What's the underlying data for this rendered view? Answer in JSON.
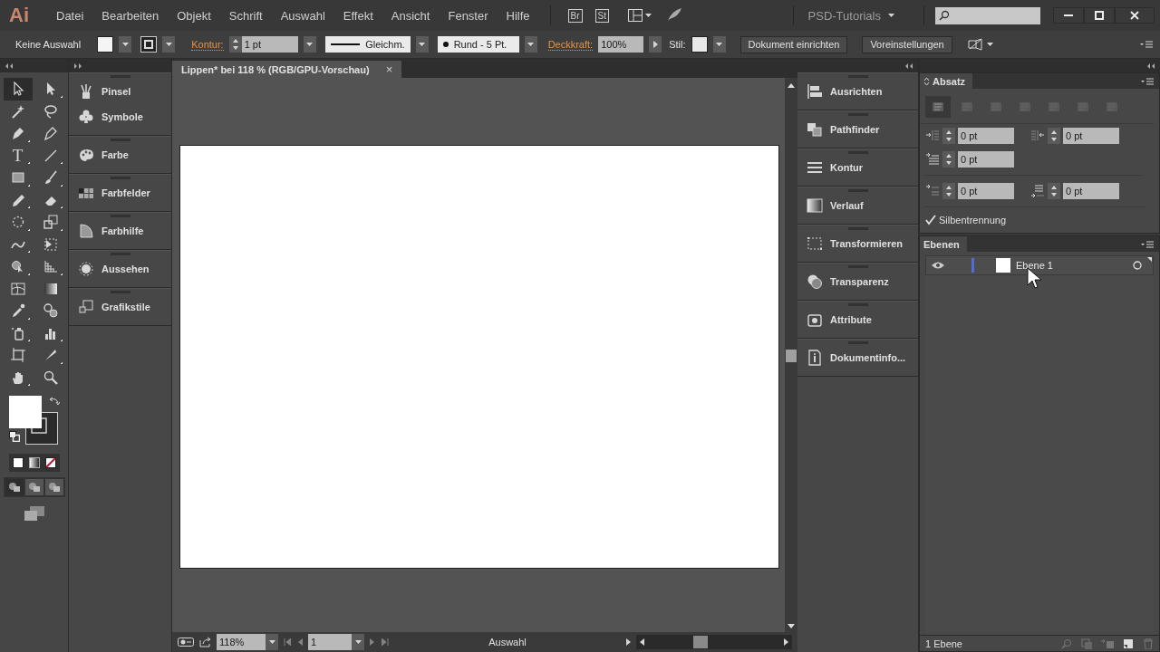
{
  "app": {
    "logo": "Ai"
  },
  "menu": [
    "Datei",
    "Bearbeiten",
    "Objekt",
    "Schrift",
    "Auswahl",
    "Effekt",
    "Ansicht",
    "Fenster",
    "Hilfe"
  ],
  "app_switcher": [
    "Br",
    "St"
  ],
  "workspace": {
    "label": "PSD-Tutorials"
  },
  "control_bar": {
    "selection": "Keine Auswahl",
    "stroke_label": "Kontur:",
    "stroke_weight": "1 pt",
    "stroke_profile": "Gleichm.",
    "brush": "Rund - 5 Pt.",
    "opacity_label": "Deckkraft:",
    "opacity_value": "100%",
    "style_label": "Stil:",
    "buttons": [
      "Dokument einrichten",
      "Voreinstellungen"
    ]
  },
  "tools": [
    {
      "kind": "selection",
      "selected": true,
      "flyout": false
    },
    {
      "kind": "direct-selection",
      "selected": false,
      "flyout": true
    },
    {
      "kind": "magic-wand",
      "selected": false,
      "flyout": false
    },
    {
      "kind": "lasso",
      "selected": false,
      "flyout": false
    },
    {
      "kind": "pen",
      "selected": false,
      "flyout": true
    },
    {
      "kind": "curvature",
      "selected": false,
      "flyout": false
    },
    {
      "kind": "type",
      "glyph": "T",
      "selected": false,
      "flyout": true
    },
    {
      "kind": "line",
      "selected": false,
      "flyout": true
    },
    {
      "kind": "rectangle",
      "selected": false,
      "flyout": true
    },
    {
      "kind": "paintbrush",
      "selected": false,
      "flyout": true
    },
    {
      "kind": "pencil",
      "selected": false,
      "flyout": true
    },
    {
      "kind": "eraser",
      "selected": false,
      "flyout": true
    },
    {
      "kind": "rotate",
      "selected": false,
      "flyout": true
    },
    {
      "kind": "scale",
      "selected": false,
      "flyout": true
    },
    {
      "kind": "warp",
      "selected": false,
      "flyout": true
    },
    {
      "kind": "free-transform",
      "selected": false,
      "flyout": false
    },
    {
      "kind": "shape-builder",
      "selected": false,
      "flyout": true
    },
    {
      "kind": "perspective",
      "selected": false,
      "flyout": true
    },
    {
      "kind": "mesh",
      "selected": false,
      "flyout": false
    },
    {
      "kind": "gradient",
      "selected": false,
      "flyout": false
    },
    {
      "kind": "eyedropper",
      "selected": false,
      "flyout": true
    },
    {
      "kind": "blend",
      "selected": false,
      "flyout": false
    },
    {
      "kind": "sprayer",
      "selected": false,
      "flyout": true
    },
    {
      "kind": "graph",
      "selected": false,
      "flyout": true
    },
    {
      "kind": "artboard",
      "selected": false,
      "flyout": false
    },
    {
      "kind": "slice",
      "selected": false,
      "flyout": true
    },
    {
      "kind": "hand",
      "selected": false,
      "flyout": true
    },
    {
      "kind": "zoom",
      "selected": false,
      "flyout": false
    }
  ],
  "color_modes": [
    {
      "kind": "color"
    },
    {
      "kind": "gradient"
    },
    {
      "kind": "none"
    }
  ],
  "draw_modes": [
    {
      "selected": true
    },
    {
      "selected": false
    },
    {
      "selected": false
    }
  ],
  "left_panels": [
    {
      "items": [
        {
          "kind": "brush",
          "label": "Pinsel"
        },
        {
          "kind": "symbol",
          "label": "Symbole"
        }
      ]
    },
    {
      "items": [
        {
          "kind": "palette",
          "label": "Farbe"
        }
      ]
    },
    {
      "items": [
        {
          "kind": "swatches",
          "label": "Farbfelder"
        }
      ]
    },
    {
      "items": [
        {
          "kind": "guide",
          "label": "Farbhilfe"
        }
      ]
    },
    {
      "items": [
        {
          "kind": "appearance",
          "label": "Aussehen"
        }
      ]
    },
    {
      "items": [
        {
          "kind": "styles",
          "label": "Grafikstile"
        }
      ]
    }
  ],
  "document": {
    "title": "Lippen* bei 118 % (RGB/GPU-Vorschau)",
    "close": "×"
  },
  "status_bar": {
    "zoom": "118%",
    "artboard": "1",
    "tool": "Auswahl"
  },
  "dock_panels": [
    {
      "items": [
        {
          "kind": "align",
          "label": "Ausrichten"
        }
      ]
    },
    {
      "items": [
        {
          "kind": "pathfinder",
          "label": "Pathfinder"
        }
      ]
    },
    {
      "items": [
        {
          "kind": "stroke",
          "label": "Kontur"
        }
      ]
    },
    {
      "items": [
        {
          "kind": "gradient",
          "label": "Verlauf"
        }
      ]
    },
    {
      "items": [
        {
          "kind": "transform",
          "label": "Transformieren"
        }
      ]
    },
    {
      "items": [
        {
          "kind": "transparency",
          "label": "Transparenz"
        }
      ]
    },
    {
      "items": [
        {
          "kind": "attributes",
          "label": "Attribute"
        }
      ]
    },
    {
      "items": [
        {
          "kind": "docinfo",
          "label": "Dokumentinfo..."
        }
      ]
    }
  ],
  "paragraph": {
    "title": "Absatz",
    "align": [
      {
        "selected": true
      },
      {
        "selected": false
      },
      {
        "selected": false
      },
      {
        "selected": false
      },
      {
        "selected": false
      },
      {
        "selected": false
      },
      {
        "selected": false
      }
    ],
    "field_rows": [
      {
        "fields": [
          {
            "kind": "indent-left",
            "value": "0 pt"
          },
          {
            "kind": "indent-right",
            "value": "0 pt"
          }
        ]
      },
      {
        "fields": [
          {
            "kind": "first-line",
            "value": "0 pt"
          }
        ]
      },
      {
        "fields": [
          {
            "kind": "space-before",
            "value": "0 pt"
          },
          {
            "kind": "space-after",
            "value": "0 pt"
          }
        ]
      }
    ],
    "hyphenation": {
      "label": "Silbentrennung",
      "checked": true
    }
  },
  "layers": {
    "title": "Ebenen",
    "items": [
      {
        "name": "Ebene 1",
        "visible": true,
        "color": "#4f6fd8"
      }
    ],
    "footer": "1 Ebene"
  }
}
